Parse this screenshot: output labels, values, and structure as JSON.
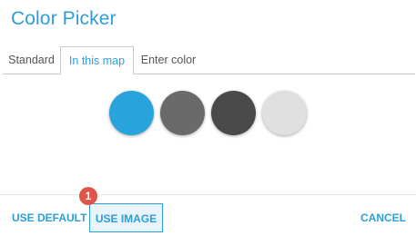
{
  "dialog": {
    "title": "Color Picker"
  },
  "tabs": [
    {
      "label": "Standard",
      "active": false
    },
    {
      "label": "In this map",
      "active": true
    },
    {
      "label": "Enter color",
      "active": false
    }
  ],
  "swatches": [
    {
      "name": "blue",
      "color": "#29a3dc"
    },
    {
      "name": "medium-gray",
      "color": "#6a6a6a"
    },
    {
      "name": "dark-gray",
      "color": "#4a4a4a"
    },
    {
      "name": "light-gray",
      "color": "#e0e0e0"
    }
  ],
  "footer": {
    "use_default_label": "USE DEFAULT",
    "use_image_label": "USE IMAGE",
    "cancel_label": "CANCEL"
  },
  "annotation": {
    "marker_label": "1"
  },
  "colors": {
    "accent": "#2d9fd8",
    "marker": "#e0554b"
  }
}
